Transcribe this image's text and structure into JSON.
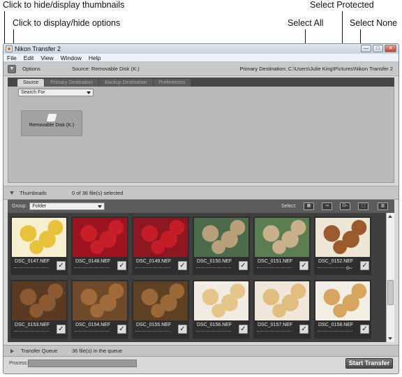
{
  "callouts": {
    "hide_thumbnails": "Click to hide/display thumbnails",
    "hide_options": "Click to display/hide options",
    "select_all": "Select All",
    "select_protected": "Select Protected",
    "select_none": "Select None"
  },
  "window": {
    "title": "Nikon Transfer 2",
    "minimize": "—",
    "maximize": "□",
    "close": "×"
  },
  "menu": [
    "File",
    "Edit",
    "View",
    "Window",
    "Help"
  ],
  "options": {
    "toggle": "▼",
    "label": "Options",
    "source": "Source: Removable Disk (K:)",
    "destination": "Primary Destination:  C:\\Users\\Julie King\\Pictures\\Nikon Transfer 2",
    "tabs": [
      "Source",
      "Primary Destination",
      "Backup Destination",
      "Preferences"
    ],
    "active_tab": 0,
    "search_for": "Search For",
    "device_label": "Removable Disk (K:)"
  },
  "thumbnails": {
    "label": "Thumbnails",
    "count": "0 of 36 file(s) selected",
    "group_label": "Group:",
    "group_value": "Folder",
    "select_label": "Select:",
    "select_buttons": [
      {
        "name": "select-all-button",
        "glyph": "▦"
      },
      {
        "name": "select-new-button",
        "glyph": "↝"
      },
      {
        "name": "select-protected-button",
        "glyph": "O‒"
      },
      {
        "name": "select-none-button",
        "glyph": "⬚"
      }
    ],
    "view_button_glyph": "▥",
    "files": [
      {
        "name": "DSC_0147.NEF",
        "color": "#e8c23a",
        "bg": "#f6f0d0"
      },
      {
        "name": "DSC_0148.NEF",
        "color": "#c81e2a",
        "bg": "#9b1420"
      },
      {
        "name": "DSC_0149.NEF",
        "color": "#c41d28",
        "bg": "#8e1620"
      },
      {
        "name": "DSC_0150.NEF",
        "color": "#b7a07a",
        "bg": "#4b6b4a"
      },
      {
        "name": "DSC_0151.NEF",
        "color": "#c7b08a",
        "bg": "#5b7d52"
      },
      {
        "name": "DSC_0152.NEF",
        "color": "#9a5a2c",
        "bg": "#eee7d6",
        "protected": true
      },
      {
        "name": "DSC_0153.NEF",
        "color": "#8b5a32",
        "bg": "#5a3a22"
      },
      {
        "name": "DSC_0154.NEF",
        "color": "#a06a3a",
        "bg": "#6f4a2a"
      },
      {
        "name": "DSC_0155.NEF",
        "color": "#9a6838",
        "bg": "#5e4024"
      },
      {
        "name": "DSC_0156.NEF",
        "color": "#e6c58a",
        "bg": "#f2ede4"
      },
      {
        "name": "DSC_0157.NEF",
        "color": "#e2bd80",
        "bg": "#eee7da"
      },
      {
        "name": "DSC_0158.NEF",
        "color": "#d8a560",
        "bg": "#f4efe6"
      }
    ],
    "check": "✓",
    "protected_icon": "O‒"
  },
  "queue": {
    "label": "Transfer Queue",
    "count": "36 file(s) in the queue"
  },
  "process": {
    "label": "Process:",
    "start_button": "Start Transfer"
  }
}
